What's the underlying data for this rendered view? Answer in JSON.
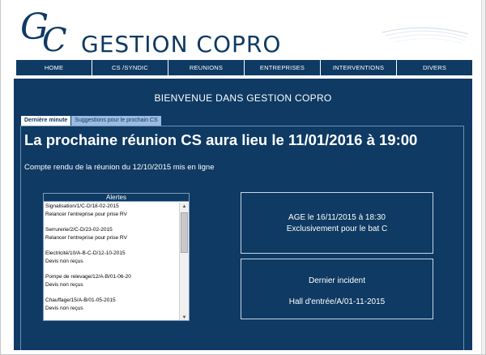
{
  "logo": {
    "letter_g": "G",
    "letter_c": "C",
    "title": "GESTION COPRO",
    "brand_color": "#0e3a63"
  },
  "nav": {
    "items": [
      {
        "label": "HOME"
      },
      {
        "label": "CS /SYNDIC"
      },
      {
        "label": "REUNIONS"
      },
      {
        "label": "ENTREPRISES"
      },
      {
        "label": "INTERVENTIONS"
      },
      {
        "label": "DIVERS"
      }
    ]
  },
  "main": {
    "welcome": "BIENVENUE DANS GESTION COPRO",
    "tabs": [
      {
        "label": "Dernière minute",
        "active": true
      },
      {
        "label": "Suggestions pour le prochain CS",
        "active": false
      }
    ],
    "headline": "La prochaine réunion CS aura lieu le 11/01/2016 à 19:00",
    "report_line": "Compte rendu de la réunion du 12/10/2015 mis en ligne",
    "alerts": {
      "title": "Alertes",
      "items": [
        {
          "title": "Signalisation/1/C-D/18-02-2015",
          "detail": "Relancer l'entreprise pour prise RV"
        },
        {
          "title": "Serrurerie/2/C-D/23-02-2015",
          "detail": "Relancer l'entreprise pour prise RV"
        },
        {
          "title": "Electricité/10/A-B-C-D/12-10-2015",
          "detail": "Devis non reçus"
        },
        {
          "title": "Pompe de relevage/12/A-B/01-06-20",
          "detail": "Devis non reçus"
        },
        {
          "title": "Chauffage/15/A-B/01-05-2015",
          "detail": "Devis non reçus"
        }
      ]
    },
    "age_box": {
      "line1": "AGE le 16/11/2015 à 18:30",
      "line2": "Exclusivement pour le bat C"
    },
    "incident_box": {
      "line1": "Dernier incident",
      "line2": "Hall d'entrée/A/01-11-2015"
    }
  },
  "icons": {
    "scroll_up": "up-arrow-icon",
    "scroll_down": "down-arrow-icon"
  }
}
